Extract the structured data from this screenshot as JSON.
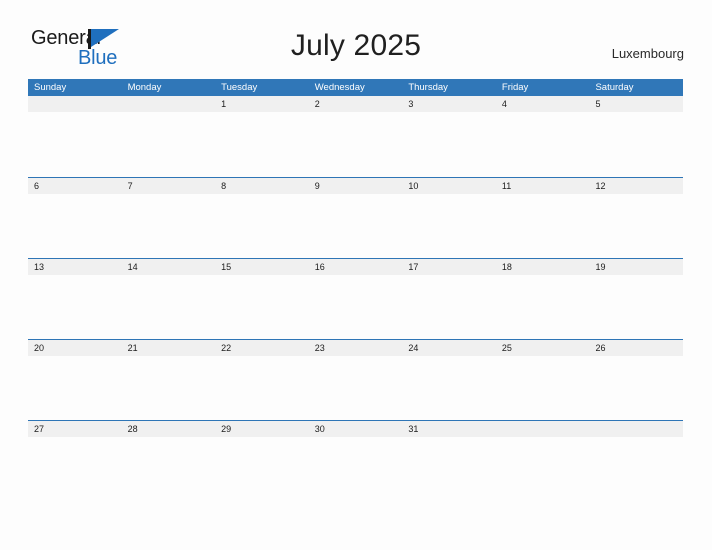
{
  "brand": {
    "name_top": "General",
    "name_bottom": "Blue",
    "flag_icon": "pennant-flag-icon",
    "accent_color": "#1f6fbe"
  },
  "header": {
    "title": "July 2025",
    "locale": "Luxembourg"
  },
  "calendar": {
    "header_bg": "#3077b8",
    "row_band_bg": "#f0f0f0",
    "row_rule_color": "#2e75b6",
    "weekday_headers": [
      "Sunday",
      "Monday",
      "Tuesday",
      "Wednesday",
      "Thursday",
      "Friday",
      "Saturday"
    ],
    "weeks": [
      [
        "",
        "",
        "1",
        "2",
        "3",
        "4",
        "5"
      ],
      [
        "6",
        "7",
        "8",
        "9",
        "10",
        "11",
        "12"
      ],
      [
        "13",
        "14",
        "15",
        "16",
        "17",
        "18",
        "19"
      ],
      [
        "20",
        "21",
        "22",
        "23",
        "24",
        "25",
        "26"
      ],
      [
        "27",
        "28",
        "29",
        "30",
        "31",
        "",
        ""
      ]
    ]
  }
}
